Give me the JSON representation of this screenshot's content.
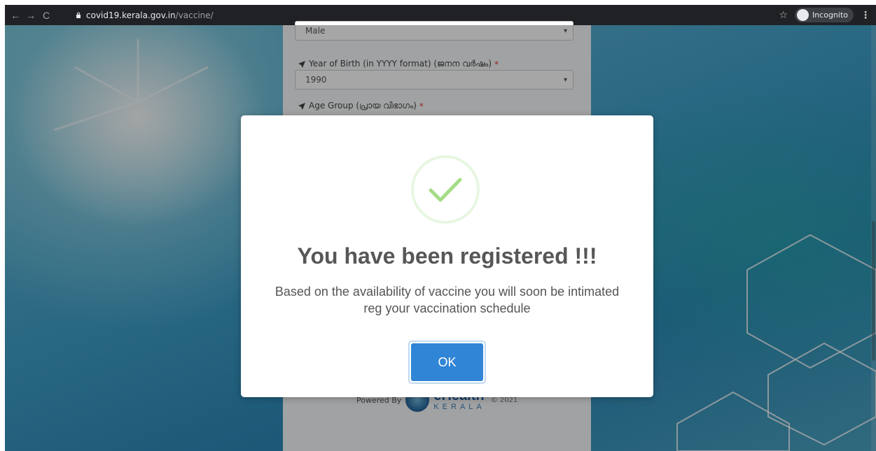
{
  "browser": {
    "url_host": "covid19.kerala.gov.in",
    "url_path": "/vaccine/",
    "incognito_label": "Incognito"
  },
  "form": {
    "gender_value": "Male",
    "year_label": "Year of Birth (in YYYY format) (ജനന വർഷം)",
    "year_value": "1990",
    "age_group_label": "Age Group (പ്രായ വിഭാഗം)",
    "required_mark": "*"
  },
  "footer": {
    "powered_by": "Powered By",
    "logo_main": "eHealth",
    "logo_sub": "KERALA",
    "copyright": "© 2021"
  },
  "modal": {
    "title": "You have been registered !!!",
    "message": "Based on the availability of vaccine you will soon be intimated reg your vaccination schedule",
    "ok_label": "OK",
    "success_color": "#a5dc86",
    "button_color": "#3085d6"
  }
}
